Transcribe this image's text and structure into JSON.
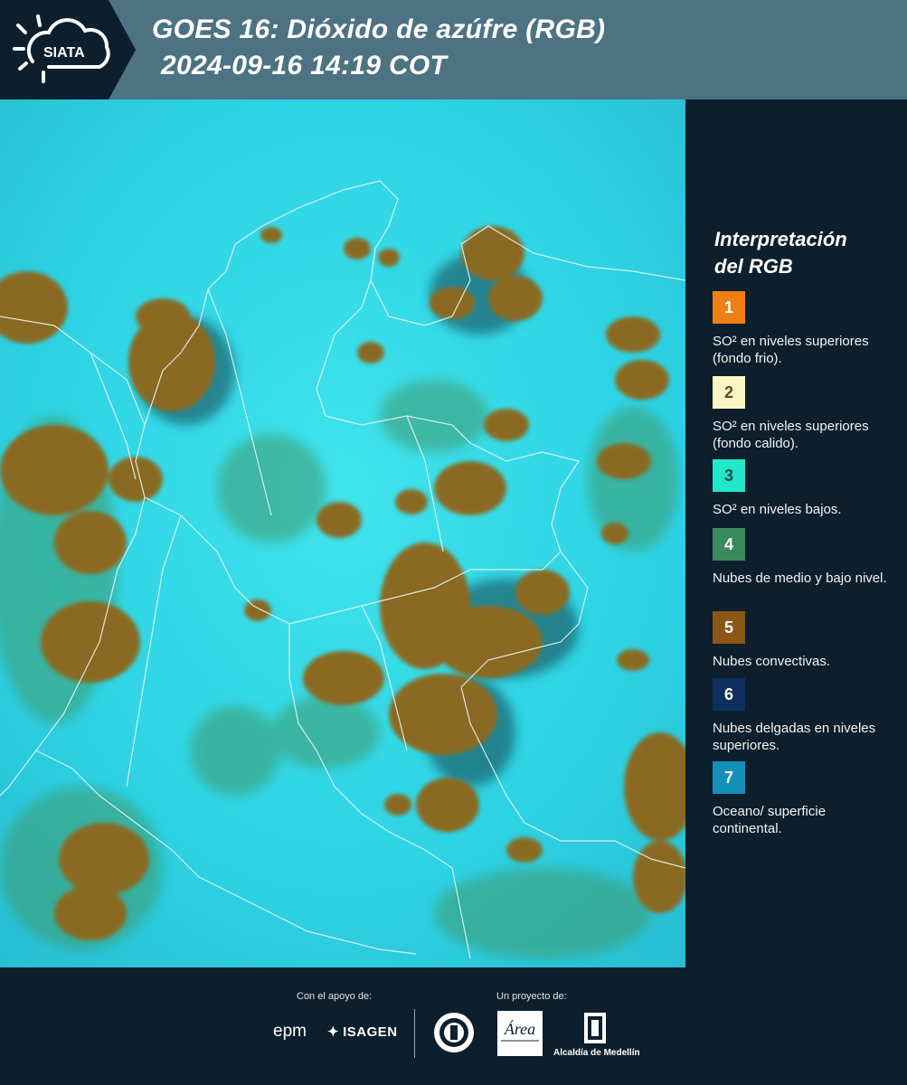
{
  "header": {
    "logo_text": "SIATA",
    "title": "GOES 16: Dióxido de azúfre (RGB)",
    "datetime": "2024-09-16 14:19 COT"
  },
  "legend": {
    "title_line1": "Interpretación",
    "title_line2": "del RGB",
    "items": [
      {
        "number": "1",
        "label": "SO² en niveles superiores (fondo frio).",
        "color": "#f07f12",
        "num_color": "#ffffff"
      },
      {
        "number": "2",
        "label": "SO² en niveles superiores (fondo calido).",
        "color": "#fbf5c4",
        "num_color": "#5a4d2a"
      },
      {
        "number": "3",
        "label": "SO² en niveles bajos.",
        "color": "#21e8c8",
        "num_color": "#0e4a52"
      },
      {
        "number": "4",
        "label": "Nubes de medio y bajo nivel.",
        "color": "#3a8a5c",
        "num_color": "#ffffff"
      },
      {
        "number": "5",
        "label": "Nubes convectivas.",
        "color": "#8a5714",
        "num_color": "#ffffff"
      },
      {
        "number": "6",
        "label": "Nubes delgadas en niveles superiores.",
        "color": "#0d2f5e",
        "num_color": "#ffffff"
      },
      {
        "number": "7",
        "label": "Oceano/ superficie continental.",
        "color": "#138fb9",
        "num_color": "#ffffff"
      }
    ]
  },
  "footer": {
    "support_caption": "Con el apoyo de:",
    "project_caption": "Un proyecto de:",
    "sponsor1": "epm",
    "sponsor2": "ISAGEN",
    "partner1": "Área Metropolitana Valle de Aburrá",
    "partner2": "Alcaldía de Medellín"
  },
  "colors": {
    "background": "#0d1f2d",
    "header_band": "#4d7383",
    "map_sky": "#2fd6e6",
    "convective": "#8a6a22",
    "low_cloud": "#3d9a6a"
  }
}
